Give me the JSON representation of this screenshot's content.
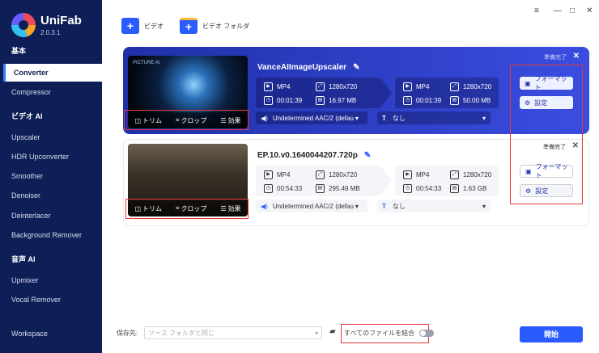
{
  "app": {
    "name": "UniFab",
    "version": "2.0.3.1"
  },
  "sidebar": {
    "sections": [
      {
        "label": "基本"
      },
      {
        "label": "ビデオ AI"
      },
      {
        "label": "音声 AI"
      }
    ],
    "items": [
      {
        "label": "Converter"
      },
      {
        "label": "Compressor"
      },
      {
        "label": "Upscaler"
      },
      {
        "label": "HDR Upconverter"
      },
      {
        "label": "Smoother"
      },
      {
        "label": "Denoiser"
      },
      {
        "label": "Deinterlacer"
      },
      {
        "label": "Background Remover"
      },
      {
        "label": "Upmixer"
      },
      {
        "label": "Vocal Remover"
      },
      {
        "label": "Workspace"
      }
    ]
  },
  "toolbar": {
    "video_label": "ビデオ",
    "folder_label": "ビデオ フォルダ"
  },
  "window": {
    "menu": "≡",
    "minimize": "—",
    "maximize": "□",
    "close": "✕"
  },
  "edit": {
    "trim": "トリム",
    "crop": "クロップ",
    "effect": "効果"
  },
  "tasks": [
    {
      "title": "VanceAIImageUpscaler",
      "status": "準備完了",
      "src": {
        "format": "MP4",
        "resolution": "1280x720",
        "duration": "00:01:39",
        "size": "16.97 MB"
      },
      "out": {
        "format": "MP4",
        "resolution": "1280x720",
        "duration": "00:01:39",
        "size": "50.00 MB"
      },
      "audio": "Undetermined AAC/2 (defau",
      "subtitle": "なし",
      "format_btn": "フォーマット",
      "settings_btn": "設定",
      "thumb_text": "PICTURE AI"
    },
    {
      "title": "EP.10.v0.1640044207.720p",
      "status": "準備完了",
      "src": {
        "format": "MP4",
        "resolution": "1280x720",
        "duration": "00:54:33",
        "size": "295.49 MB"
      },
      "out": {
        "format": "MP4",
        "resolution": "1280x720",
        "duration": "00:54:33",
        "size": "1.63 GB"
      },
      "audio": "Undetermined AAC/2 (defau",
      "subtitle": "なし",
      "format_btn": "フォーマット",
      "settings_btn": "設定"
    }
  ],
  "footer": {
    "save_label": "保存先:",
    "save_placeholder": "ソース フォルダと同じ",
    "merge_label": "すべてのファイルを結合",
    "start_label": "開始"
  },
  "colors": {
    "sidebar": "#0e1f57",
    "accent": "#2a5bff",
    "highlight": "#e53935"
  }
}
